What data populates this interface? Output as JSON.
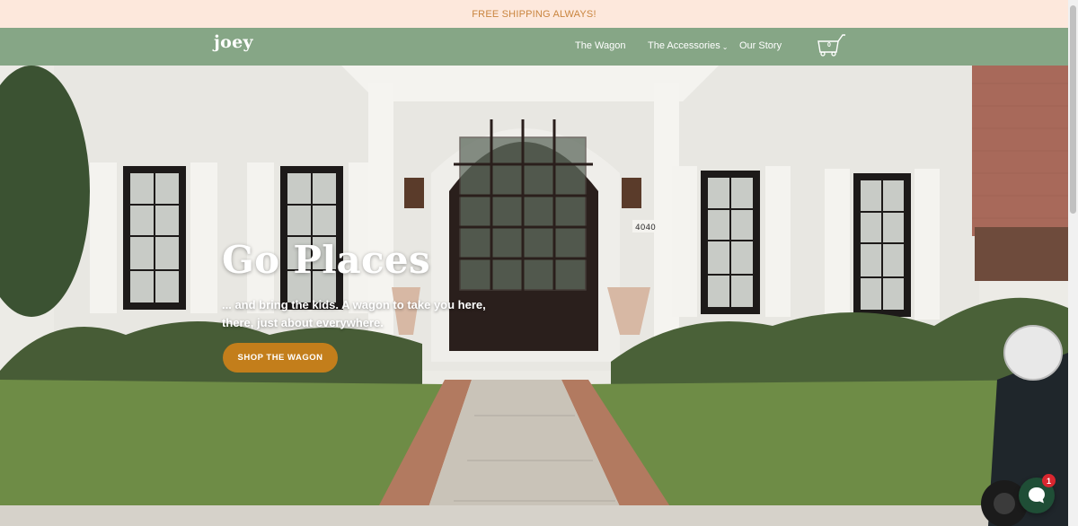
{
  "announcement": {
    "text": "FREE SHIPPING ALWAYS!"
  },
  "header": {
    "logo": "joey",
    "nav": [
      {
        "label": "The Wagon"
      },
      {
        "label": "The Accessories",
        "chevron": "⌄"
      },
      {
        "label": "Our Story"
      }
    ],
    "cart": {
      "count": "0",
      "icon": "wagon-cart-icon"
    }
  },
  "hero": {
    "house_number": "4040",
    "title": "Go Places",
    "subtitle": "... and bring the kids. A wagon to take you here, there, just about everywhere.",
    "cta_label": "SHOP THE WAGON"
  },
  "chat": {
    "badge": "1",
    "icon": "chat-bubble-icon"
  },
  "colors": {
    "announcement_bg": "#fde8dc",
    "announcement_text": "#c9853f",
    "header_bg": "#86a686",
    "cta_bg": "#c37e1b",
    "chat_bg": "#1f4e36",
    "badge_bg": "#d9262f"
  }
}
